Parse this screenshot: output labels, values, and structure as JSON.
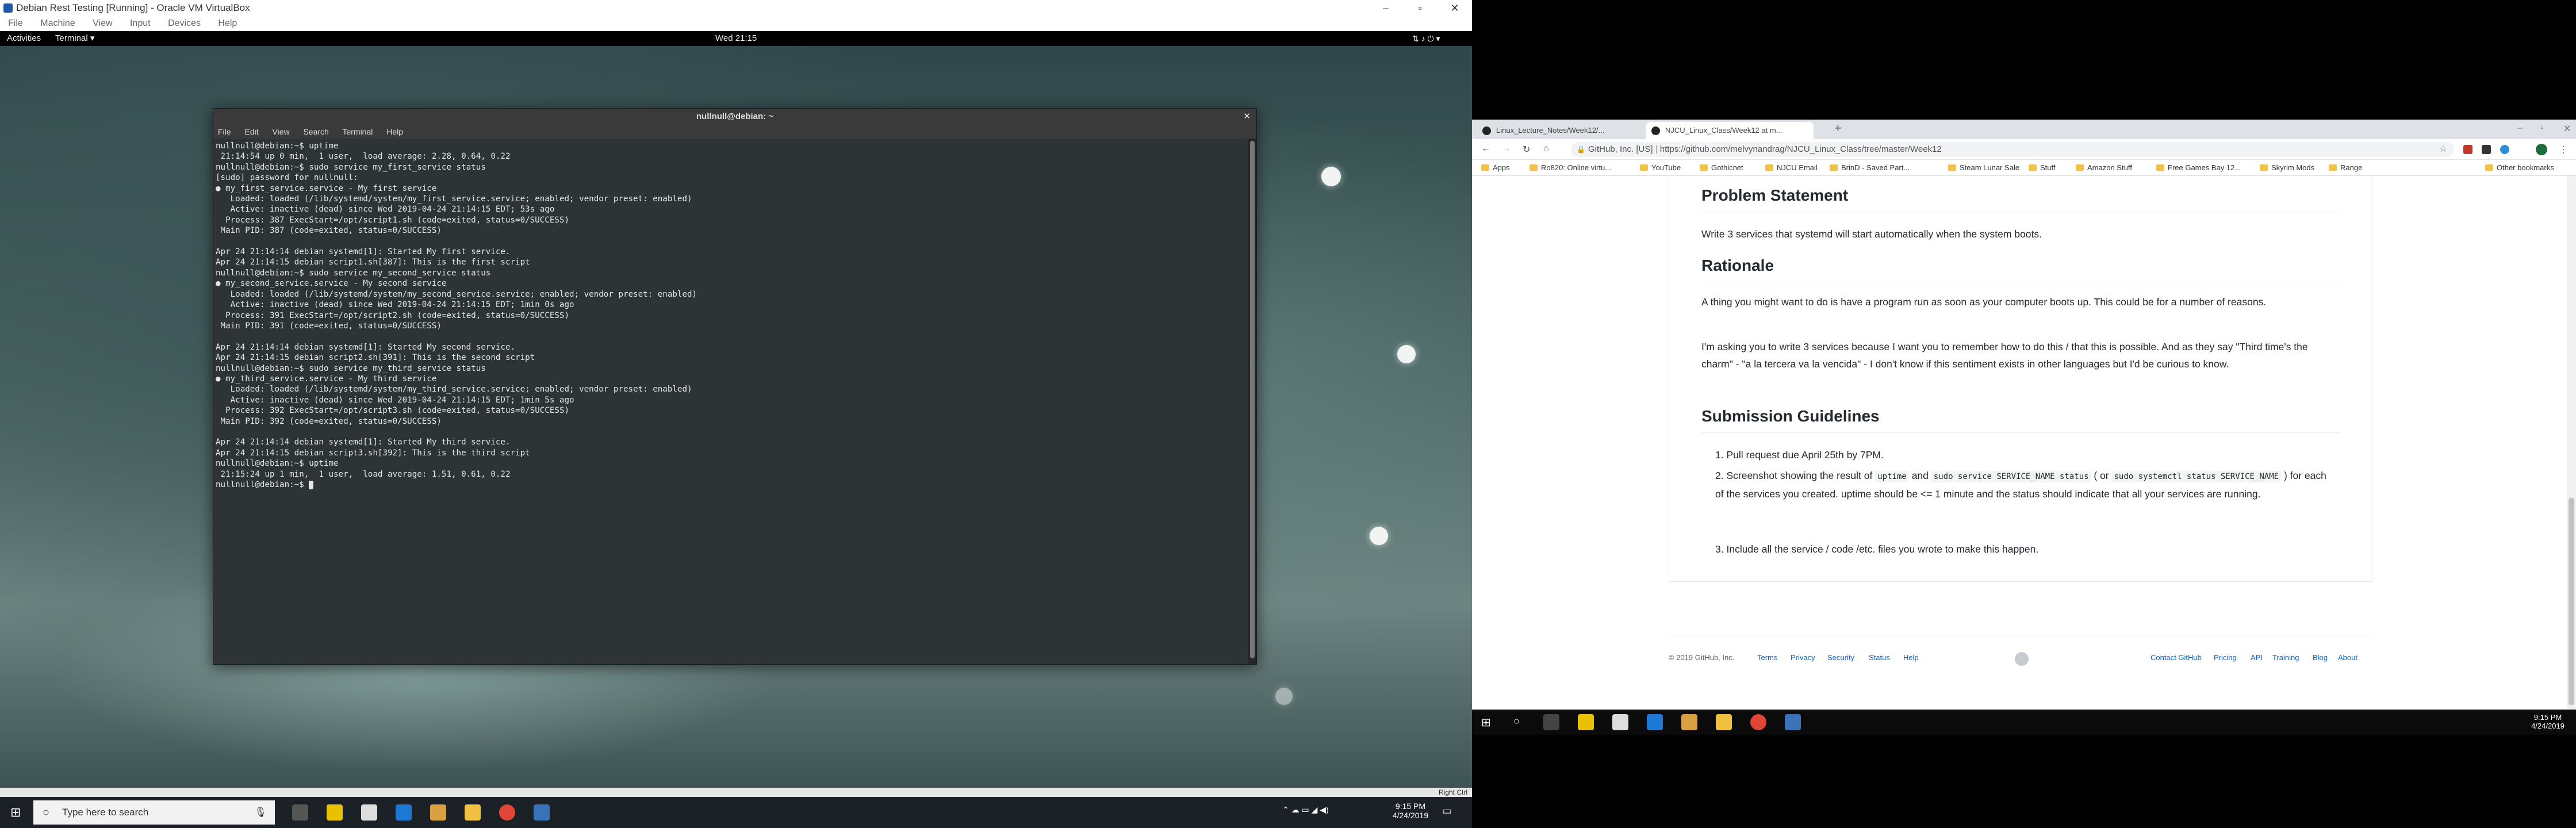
{
  "vm": {
    "title": "Debian Rest Testing [Running] - Oracle VM VirtualBox",
    "menu": [
      "File",
      "Machine",
      "View",
      "Input",
      "Devices",
      "Help"
    ],
    "status_host_key": "Right Ctrl"
  },
  "gnome": {
    "activities": "Activities",
    "app": "Terminal ▾",
    "clock": "Wed 21:15"
  },
  "terminal": {
    "title": "nullnull@debian: ~",
    "menu": [
      "File",
      "Edit",
      "View",
      "Search",
      "Terminal",
      "Help"
    ],
    "lines": [
      "nullnull@debian:~$ uptime",
      " 21:14:54 up 0 min,  1 user,  load average: 2.28, 0.64, 0.22",
      "nullnull@debian:~$ sudo service my_first_service status",
      "[sudo] password for nullnull:",
      "● my_first_service.service - My first service",
      "   Loaded: loaded (/lib/systemd/system/my_first_service.service; enabled; vendor preset: enabled)",
      "   Active: inactive (dead) since Wed 2019-04-24 21:14:15 EDT; 53s ago",
      "  Process: 387 ExecStart=/opt/script1.sh (code=exited, status=0/SUCCESS)",
      " Main PID: 387 (code=exited, status=0/SUCCESS)",
      "",
      "Apr 24 21:14:14 debian systemd[1]: Started My first service.",
      "Apr 24 21:14:15 debian script1.sh[387]: This is the first script",
      "nullnull@debian:~$ sudo service my_second_service status",
      "● my_second_service.service - My second service",
      "   Loaded: loaded (/lib/systemd/system/my_second_service.service; enabled; vendor preset: enabled)",
      "   Active: inactive (dead) since Wed 2019-04-24 21:14:15 EDT; 1min 0s ago",
      "  Process: 391 ExecStart=/opt/script2.sh (code=exited, status=0/SUCCESS)",
      " Main PID: 391 (code=exited, status=0/SUCCESS)",
      "",
      "Apr 24 21:14:14 debian systemd[1]: Started My second service.",
      "Apr 24 21:14:15 debian script2.sh[391]: This is the second script",
      "nullnull@debian:~$ sudo service my_third_service status",
      "● my_third_service.service - My third service",
      "   Loaded: loaded (/lib/systemd/system/my_third_service.service; enabled; vendor preset: enabled)",
      "   Active: inactive (dead) since Wed 2019-04-24 21:14:15 EDT; 1min 5s ago",
      "  Process: 392 ExecStart=/opt/script3.sh (code=exited, status=0/SUCCESS)",
      " Main PID: 392 (code=exited, status=0/SUCCESS)",
      "",
      "Apr 24 21:14:14 debian systemd[1]: Started My third service.",
      "Apr 24 21:14:15 debian script3.sh[392]: This is the third script",
      "nullnull@debian:~$ uptime",
      " 21:15:24 up 1 min,  1 user,  load average: 1.51, 0.61, 0.22",
      "nullnull@debian:~$ "
    ]
  },
  "taskbar_left": {
    "search_placeholder": "Type here to search",
    "time": "9:15 PM",
    "date": "4/24/2019"
  },
  "chrome": {
    "tabs": [
      {
        "title": "Linux_Lecture_Notes/Week12/..."
      },
      {
        "title": "NJCU_Linux_Class/Week12 at m..."
      }
    ],
    "new_tab": "+",
    "url_prefix": "GitHub, Inc. [US]",
    "url": "https://github.com/melvynandrag/NJCU_Linux_Class/tree/master/Week12",
    "bookmarks": [
      "Apps",
      "Ro820: Online virtu...",
      "YouTube",
      "Gothicnet",
      "NJCU Email",
      "BrinD - Saved Part...",
      "Steam Lunar Sale",
      "Stuff",
      "Amazon Stuff",
      "Free Games Bay 12...",
      "Skyrim Mods",
      "Range"
    ],
    "other_bookmarks": "Other bookmarks"
  },
  "article": {
    "h_problem": "Problem Statement",
    "p_problem": "Write 3 services that systemd will start automatically when the system boots.",
    "h_rationale": "Rationale",
    "p_rationale1": "A thing you might want to do is have a program run as soon as your computer boots up. This could be for a number of reasons.",
    "p_rationale2": "I'm asking you to write 3 services because I want you to remember how to do this / that this is possible. And as they say \"Third time's the charm\" - \"a la tercera va la vencida\" - I don't know if this sentiment exists in other languages but I'd be curious to know.",
    "h_submission": "Submission Guidelines",
    "li1": "Pull request due April 25th by 7PM.",
    "li2_a": "Screenshot showing the result of",
    "li2_code1": "uptime",
    "li2_b": "and",
    "li2_code2": "sudo service SERVICE_NAME status",
    "li2_c": "( or",
    "li2_code3": "sudo systemctl status SERVICE_NAME",
    "li2_d": ") for each of the services you created. uptime should be <= 1 minute and the status should indicate that all your services are running.",
    "li3": "Include all the service / code /etc. files you wrote to make this happen."
  },
  "footer": {
    "copyright": "© 2019 GitHub, Inc.",
    "left_links": [
      "Terms",
      "Privacy",
      "Security",
      "Status",
      "Help"
    ],
    "right_links": [
      "Contact GitHub",
      "Pricing",
      "API",
      "Training",
      "Blog",
      "About"
    ]
  },
  "taskbar_right": {
    "time": "9:15 PM",
    "date": "4/24/2019"
  }
}
